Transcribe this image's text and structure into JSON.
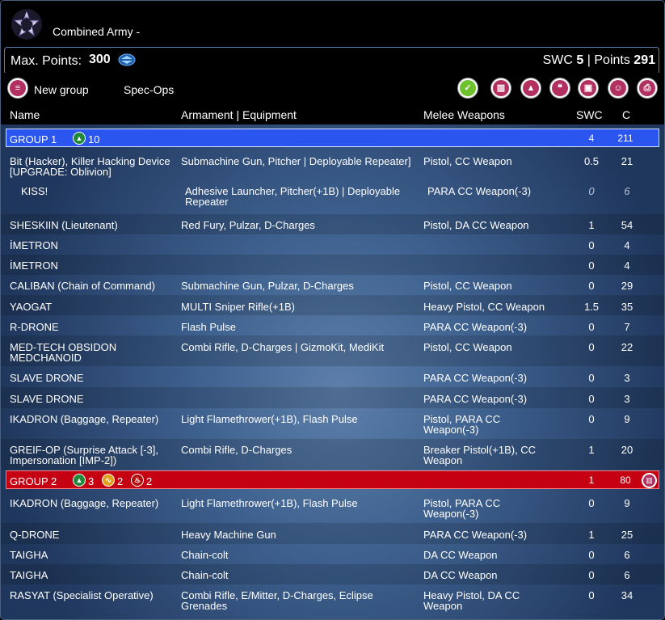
{
  "header": {
    "army_title": "Combined Army -",
    "logo_icon": "combined-army-logo"
  },
  "points_bar": {
    "max_points_label": "Max. Points:",
    "max_points_value": "300",
    "swc_label": "SWC",
    "swc_value": "5",
    "separator": "|",
    "points_label": "Points",
    "points_value": "291"
  },
  "toolbar": {
    "new_group_label": "New group",
    "specops_label": "Spec-Ops",
    "icons": [
      "new-group-icon",
      "validate-check-icon",
      "delete-trash-icon",
      "army-warning-icon",
      "chat-icon",
      "save-disk-icon",
      "smiley-icon",
      "print-icon"
    ]
  },
  "columns": {
    "name": "Name",
    "armament": "Armament | Equipment",
    "melee": "Melee Weapons",
    "swc": "SWC",
    "c": "C"
  },
  "group1": {
    "label": "GROUP 1",
    "order_count": "10",
    "swc": "4",
    "c": "211"
  },
  "group2": {
    "label": "GROUP 2",
    "regular_count": "3",
    "irregular_count": "2",
    "impetuous_count": "2",
    "swc": "1",
    "c": "80"
  },
  "rows": [
    {
      "name": "Bit (Hacker), Killer Hacking Device [UPGRADE: Oblivion]",
      "armament": "Submachine Gun, Pitcher | Deployable Repeater]",
      "melee": "Pistol, CC Weapon",
      "swc": "0.5",
      "c": "21"
    },
    {
      "name": "KISS!",
      "armament": "Adhesive Launcher, Pitcher(+1B) | Deployable Repeater",
      "melee": "PARA CC Weapon(-3)",
      "swc": "0",
      "c": "6"
    },
    {
      "name": "SHESKIIN (Lieutenant)",
      "armament": "Red Fury, Pulzar, D-Charges",
      "melee": "Pistol, DA CC Weapon",
      "swc": "1",
      "c": "54"
    },
    {
      "name": "İMETRON",
      "armament": "",
      "melee": "",
      "swc": "0",
      "c": "4"
    },
    {
      "name": "İMETRON",
      "armament": "",
      "melee": "",
      "swc": "0",
      "c": "4"
    },
    {
      "name": "CALIBAN (Chain of Command)",
      "armament": "Submachine Gun, Pulzar, D-Charges",
      "melee": "Pistol, CC Weapon",
      "swc": "0",
      "c": "29"
    },
    {
      "name": "YAOGAT",
      "armament": "MULTI Sniper Rifle(+1B)",
      "melee": "Heavy Pistol, CC Weapon",
      "swc": "1.5",
      "c": "35"
    },
    {
      "name": "R-DRONE",
      "armament": "Flash Pulse",
      "melee": "PARA CC Weapon(-3)",
      "swc": "0",
      "c": "7"
    },
    {
      "name": "MED-TECH OBSIDON MEDCHANOID",
      "armament": "Combi Rifle, D-Charges | GizmoKit, MediKit",
      "melee": "Pistol, CC Weapon",
      "swc": "0",
      "c": "22"
    },
    {
      "name": "SLAVE DRONE",
      "armament": "",
      "melee": "PARA CC Weapon(-3)",
      "swc": "0",
      "c": "3"
    },
    {
      "name": "SLAVE DRONE",
      "armament": "",
      "melee": "PARA CC Weapon(-3)",
      "swc": "0",
      "c": "3"
    },
    {
      "name": "IKADRON (Baggage, Repeater)",
      "armament": "Light Flamethrower(+1B), Flash Pulse",
      "melee": "Pistol, PARA CC Weapon(-3)",
      "swc": "0",
      "c": "9"
    },
    {
      "name": "GREIF-OP (Surprise Attack [-3], Impersonation [IMP-2])",
      "armament": "Combi Rifle, D-Charges",
      "melee": "Breaker Pistol(+1B), CC Weapon",
      "swc": "1",
      "c": "20"
    },
    {
      "name": "IKADRON (Baggage, Repeater)",
      "armament": "Light Flamethrower(+1B), Flash Pulse",
      "melee": "Pistol, PARA CC Weapon(-3)",
      "swc": "0",
      "c": "9"
    },
    {
      "name": "Q-DRONE",
      "armament": "Heavy Machine Gun",
      "melee": "PARA CC Weapon(-3)",
      "swc": "1",
      "c": "25"
    },
    {
      "name": "TAIGHA",
      "armament": "Chain-colt",
      "melee": "DA CC Weapon",
      "swc": "0",
      "c": "6"
    },
    {
      "name": "TAIGHA",
      "armament": "Chain-colt",
      "melee": "DA CC Weapon",
      "swc": "0",
      "c": "6"
    },
    {
      "name": "RASYAT (Specialist Operative)",
      "armament": "Combi Rifle, E/Mitter, D-Charges, Eclipse Grenades",
      "melee": "Heavy Pistol, DA CC Weapon",
      "swc": "0",
      "c": "34"
    }
  ]
}
